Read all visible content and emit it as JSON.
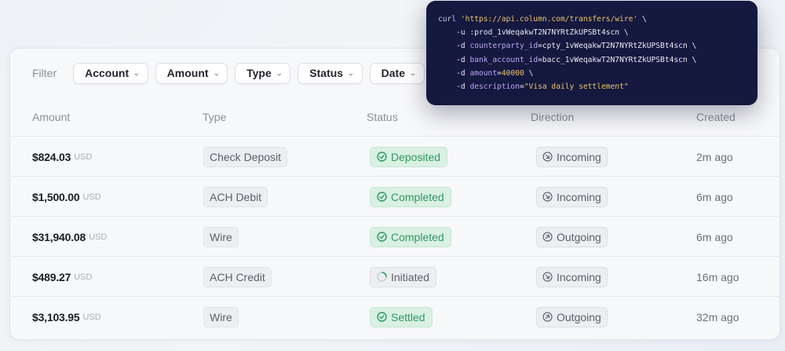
{
  "filters": {
    "label": "Filter",
    "buttons": [
      "Account",
      "Amount",
      "Type",
      "Status",
      "Date"
    ]
  },
  "table": {
    "headers": [
      "Amount",
      "Type",
      "Status",
      "Direction",
      "Created"
    ],
    "rows": [
      {
        "amount": "$824.03",
        "currency": "USD",
        "type": "Check Deposit",
        "status": "Deposited",
        "status_kind": "success",
        "direction": "Incoming",
        "created": "2m ago"
      },
      {
        "amount": "$1,500.00",
        "currency": "USD",
        "type": "ACH Debit",
        "status": "Completed",
        "status_kind": "success",
        "direction": "Incoming",
        "created": "6m ago"
      },
      {
        "amount": "$31,940.08",
        "currency": "USD",
        "type": "Wire",
        "status": "Completed",
        "status_kind": "success",
        "direction": "Outgoing",
        "created": "6m ago"
      },
      {
        "amount": "$489.27",
        "currency": "USD",
        "type": "ACH Credit",
        "status": "Initiated",
        "status_kind": "pending",
        "direction": "Incoming",
        "created": "16m ago"
      },
      {
        "amount": "$3,103.95",
        "currency": "USD",
        "type": "Wire",
        "status": "Settled",
        "status_kind": "success",
        "direction": "Outgoing",
        "created": "32m ago"
      }
    ]
  },
  "code": {
    "cmd": "curl",
    "url": "'https://api.column.com/transfers/wire'",
    "cont": "\\",
    "auth_flag": "-u",
    "auth_value": ":prod_1vWeqakwT2N7NYRtZkUPSBt4scn",
    "data_flag": "-d",
    "params": [
      {
        "key": "counterparty_id",
        "value": "cpty_1vWeqakwT2N7NYRtZkUPSBt4scn",
        "kind": "plain"
      },
      {
        "key": "bank_account_id",
        "value": "bacc_1vWeqakwT2N7NYRtZkUPSBt4scn",
        "kind": "plain"
      },
      {
        "key": "amount",
        "value": "40000",
        "kind": "num"
      },
      {
        "key": "description",
        "value": "\"Visa daily settlement\"",
        "kind": "str"
      }
    ]
  },
  "colors": {
    "success_text": "#2f9a62",
    "success_bg": "#d9f0e3",
    "code_bg": "#15183f",
    "code_string": "#e9c46a",
    "code_key": "#b9a6f5"
  }
}
